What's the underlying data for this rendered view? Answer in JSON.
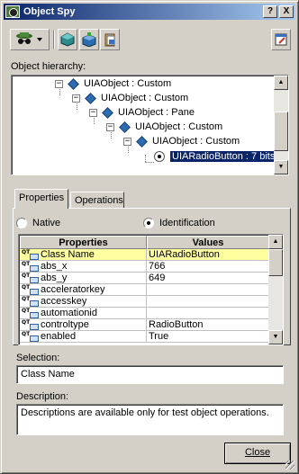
{
  "window": {
    "title": "Object Spy",
    "help_btn": "?",
    "close_btn": "X"
  },
  "toolbar": {
    "buttons": [
      {
        "icon": "spy-icon",
        "name": "pointing-hand"
      },
      {
        "icon": "add-object-icon"
      },
      {
        "icon": "add-all-objects-icon"
      },
      {
        "icon": "clipboard-icon"
      },
      {
        "icon": "keep-on-top-icon"
      }
    ]
  },
  "hierarchy": {
    "label": "Object hierarchy:",
    "nodes": [
      {
        "text": "UIAObject : Custom",
        "level": 0
      },
      {
        "text": "UIAObject : Custom",
        "level": 1
      },
      {
        "text": "UIAObject : Pane",
        "level": 2
      },
      {
        "text": "UIAObject : Custom",
        "level": 3
      },
      {
        "text": "UIAObject : Custom",
        "level": 4
      },
      {
        "text": "UIARadioButton : 7 bits",
        "level": 5,
        "selected": true
      }
    ]
  },
  "tabs": [
    {
      "label": "Properties",
      "active": true
    },
    {
      "label": "Operations",
      "active": false
    }
  ],
  "mode": {
    "native_label": "Native",
    "identification_label": "Identification",
    "selected": "identification"
  },
  "grid": {
    "headers": [
      "Properties",
      "Values"
    ],
    "rows": [
      {
        "prop": "Class Name",
        "value": "UIARadioButton",
        "selected": true
      },
      {
        "prop": "abs_x",
        "value": "766"
      },
      {
        "prop": "abs_y",
        "value": "649"
      },
      {
        "prop": "acceleratorkey",
        "value": ""
      },
      {
        "prop": "accesskey",
        "value": ""
      },
      {
        "prop": "automationid",
        "value": ""
      },
      {
        "prop": "controltype",
        "value": "RadioButton"
      },
      {
        "prop": "enabled",
        "value": "True"
      }
    ],
    "icon_text": "QT"
  },
  "selection": {
    "label": "Selection:",
    "value": "Class Name"
  },
  "description": {
    "label": "Description:",
    "value": "Descriptions are available only for test object operations."
  },
  "close_button": {
    "label": "Close"
  },
  "colors": {
    "title_start": "#0a246a",
    "title_end": "#a6caf0",
    "selection": "#0a246a",
    "row_highlight": "#ffffa0"
  }
}
